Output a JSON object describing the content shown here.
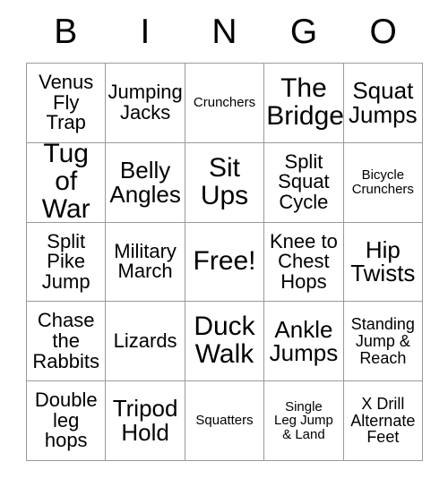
{
  "card": {
    "headers": [
      "B",
      "I",
      "N",
      "G",
      "O"
    ],
    "rows": [
      [
        {
          "label": "Venus\nFly\nTrap",
          "size": "fs-md"
        },
        {
          "label": "Jumping\nJacks",
          "size": "fs-md"
        },
        {
          "label": "Crunchers",
          "size": "fs-xs"
        },
        {
          "label": "The\nBridge",
          "size": "fs-xl"
        },
        {
          "label": "Squat\nJumps",
          "size": "fs-lg"
        }
      ],
      [
        {
          "label": "Tug of\nWar",
          "size": "fs-xl"
        },
        {
          "label": "Belly\nAngles",
          "size": "fs-lg"
        },
        {
          "label": "Sit\nUps",
          "size": "fs-xl"
        },
        {
          "label": "Split\nSquat\nCycle",
          "size": "fs-md"
        },
        {
          "label": "Bicycle\nCrunchers",
          "size": "fs-xs"
        }
      ],
      [
        {
          "label": "Split\nPike\nJump",
          "size": "fs-md"
        },
        {
          "label": "Military\nMarch",
          "size": "fs-md"
        },
        {
          "label": "Free!",
          "size": "fs-xl"
        },
        {
          "label": "Knee to\nChest\nHops",
          "size": "fs-md"
        },
        {
          "label": "Hip\nTwists",
          "size": "fs-lg"
        }
      ],
      [
        {
          "label": "Chase\nthe\nRabbits",
          "size": "fs-md"
        },
        {
          "label": "Lizards",
          "size": "fs-md"
        },
        {
          "label": "Duck\nWalk",
          "size": "fs-xl"
        },
        {
          "label": "Ankle\nJumps",
          "size": "fs-lg"
        },
        {
          "label": "Standing\nJump &\nReach",
          "size": "fs-sm"
        }
      ],
      [
        {
          "label": "Double\nleg\nhops",
          "size": "fs-md"
        },
        {
          "label": "Tripod\nHold",
          "size": "fs-lg"
        },
        {
          "label": "Squatters",
          "size": "fs-xs"
        },
        {
          "label": "Single\nLeg Jump\n& Land",
          "size": "fs-xs"
        },
        {
          "label": "X Drill\nAlternate\nFeet",
          "size": "fs-sm"
        }
      ]
    ]
  },
  "colors": {
    "border": "#9a9a9a",
    "text": "#000000",
    "background": "#ffffff"
  }
}
